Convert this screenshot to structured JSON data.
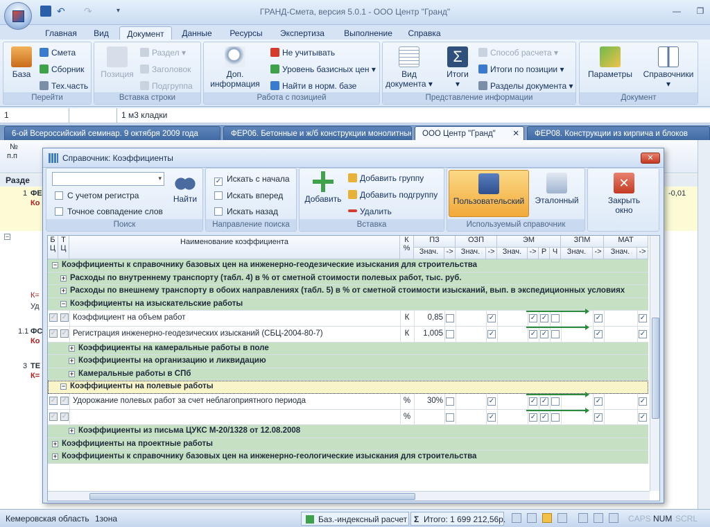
{
  "window": {
    "title": "ГРАНД-Смета, версия 5.0.1 - ООО Центр \"Гранд\""
  },
  "ribbon_tabs": [
    "Главная",
    "Вид",
    "Документ",
    "Данные",
    "Ресурсы",
    "Экспертиза",
    "Выполнение",
    "Справка"
  ],
  "ribbon": {
    "goto": {
      "caption": "Перейти",
      "big": "База",
      "items": [
        "Смета",
        "Сборник",
        "Тех.часть"
      ]
    },
    "insert_row": {
      "caption": "Вставка строки",
      "big": "Позиция",
      "items": [
        "Раздел",
        "Заголовок",
        "Подгруппа"
      ]
    },
    "position_work": {
      "caption": "Работа с позицией",
      "big1": "Доп.",
      "big2": "информация",
      "items": [
        "Не учитывать",
        "Уровень базисных цен",
        "Найти в норм. базе"
      ]
    },
    "info_view": {
      "caption": "Представление информации",
      "big1": "Вид",
      "big2": "документа",
      "big3": "Итоги",
      "items": [
        "Способ расчета",
        "Итоги по позиции",
        "Разделы документа"
      ]
    },
    "document": {
      "caption": "Документ",
      "b1": "Параметры",
      "b2": "Справочники"
    }
  },
  "formula_bar": {
    "cell": "1",
    "value": "1 м3 кладки"
  },
  "doc_tabs": [
    "6-ой Всероссийский семинар. 9 октября 2009 года",
    "ФЕР06. Бетонные и ж/б конструкции монолитные",
    "ООО Центр \"Гранд\"",
    "ФЕР08. Конструкции из кирпича и блоков"
  ],
  "sheet": {
    "col1a": "№",
    "col1b": "п.п",
    "section": "Разде",
    "r1n": "1",
    "r1t": "ФЕ",
    "r1b": "Ко",
    "v1": "-0,01",
    "k1": "К=",
    "u1": "Уд",
    "r2n": "1.1",
    "r2t": "ФС",
    "r2b": "Ко",
    "r3n": "3",
    "r3t": "ТЕ",
    "r3b": "К="
  },
  "dialog": {
    "title": "Справочник: Коэффициенты",
    "search": {
      "caption": "Поиск",
      "case": "С учетом регистра",
      "exact": "Точное совпадение слов",
      "find": "Найти"
    },
    "direction": {
      "caption": "Направление поиска",
      "from_start": "Искать с начала",
      "forward": "Искать вперед",
      "back": "Искать назад"
    },
    "insert": {
      "caption": "Вставка",
      "add": "Добавить",
      "add_group": "Добавить группу",
      "add_subgroup": "Добавить подгруппу",
      "delete": "Удалить"
    },
    "used_ref": {
      "caption": "Используемый справочник",
      "user": "Пользовательский",
      "ref": "Эталонный"
    },
    "close": {
      "l1": "Закрыть",
      "l2": "окно"
    }
  },
  "grid": {
    "headers": {
      "bc1": "Б",
      "bc2": "Ц",
      "tc1": "Т",
      "tc2": "Ц",
      "name": "Наименование коэффициента",
      "k1": "К",
      "k2": "%",
      "pz": "ПЗ",
      "ozp": "ОЗП",
      "em": "ЭМ",
      "zpm": "ЗПМ",
      "mat": "МАТ",
      "val": "Знач.",
      "arr": "->",
      "r": "Р",
      "ch": "Ч"
    },
    "rows": [
      {
        "type": "grp",
        "level": 0,
        "sign": "−",
        "text": "Коэффициенты к справочнику базовых цен на инженерно-геодезические изыскания для строительства"
      },
      {
        "type": "grp",
        "level": 1,
        "sign": "+",
        "text": "Расходы по внутреннему транспорту (табл. 4) в % от сметной стоимости полевых работ, тыс. руб."
      },
      {
        "type": "grp",
        "level": 1,
        "sign": "+",
        "text": "Расходы по внешнему транспорту в обоих направлениях (табл. 5) в % от сметной стоимости изысканий, вып. в экспедиционных условиях"
      },
      {
        "type": "grp",
        "level": 1,
        "sign": "−",
        "text": "Коэффициенты на изыскательские работы"
      },
      {
        "type": "item",
        "text": "Коэффициент на объем работ",
        "k": "К",
        "val": "0,85"
      },
      {
        "type": "item",
        "text": "Регистрация инженерно-геодезических изысканий (СБЦ-2004-80-7)",
        "k": "К",
        "val": "1,005"
      },
      {
        "type": "grp",
        "level": 2,
        "sign": "+",
        "text": "Коэффициенты на камеральные работы в поле"
      },
      {
        "type": "grp",
        "level": 2,
        "sign": "+",
        "text": "Коэффициенты на организацию и ликвидацию"
      },
      {
        "type": "grp",
        "level": 2,
        "sign": "+",
        "text": "Камеральные работы в СПб"
      },
      {
        "type": "sel",
        "level": 1,
        "sign": "−",
        "text": "Коэффициенты на полевые работы"
      },
      {
        "type": "item",
        "text": "Удорожание полевых работ за счет неблагоприятного периода",
        "k": "%",
        "val": "30%"
      },
      {
        "type": "item",
        "text": "",
        "k": "%",
        "val": ""
      },
      {
        "type": "grp",
        "level": 2,
        "sign": "+",
        "text": "Коэффициенты из письма ЦУКС М-20/1328 от 12.08.2008"
      },
      {
        "type": "grp",
        "level": 0,
        "sign": "+",
        "text": "Коэффициенты на проектные работы"
      },
      {
        "type": "grp",
        "level": 0,
        "sign": "+",
        "text": "Коэффициенты к справочнику базовых цен на инженерно-геологические изыскания для строительства"
      }
    ]
  },
  "status": {
    "region": "Кемеровская область",
    "zone": "1зона",
    "mode": "Баз.-индексный расчет",
    "total": "Итого: 1 699 212,56р.",
    "caps": "CAPS",
    "num": "NUM",
    "scrl": "SCRL"
  }
}
